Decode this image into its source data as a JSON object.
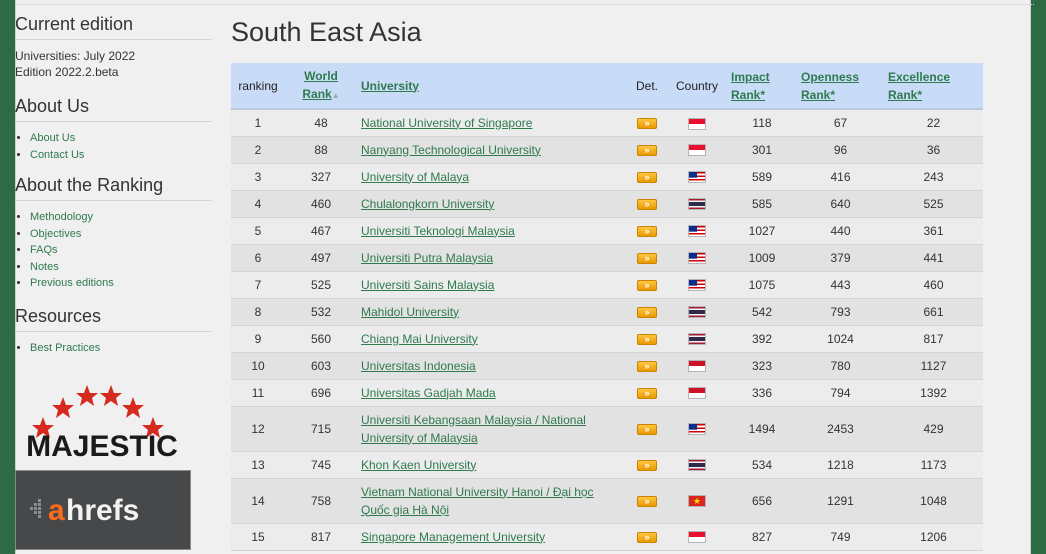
{
  "sidebar": {
    "current_edition": {
      "heading": "Current edition",
      "line1": "Universities: July 2022",
      "line2": "Edition 2022.2.beta"
    },
    "about_us": {
      "heading": "About Us",
      "items": [
        "About Us",
        "Contact Us"
      ]
    },
    "about_ranking": {
      "heading": "About the Ranking",
      "items": [
        "Methodology",
        "Objectives",
        "FAQs",
        "Notes",
        "Previous editions"
      ]
    },
    "resources": {
      "heading": "Resources",
      "items": [
        "Best Practices"
      ]
    },
    "logos": {
      "majestic": "MAJESTIC",
      "ahrefs_a": "a",
      "ahrefs_rest": "hrefs"
    }
  },
  "main": {
    "title": "South East Asia",
    "columns": {
      "ranking": "ranking",
      "world_rank_1": "World",
      "world_rank_2": "Rank",
      "university": "University",
      "det": "Det.",
      "country": "Country",
      "impact_1": "Impact",
      "impact_2": "Rank*",
      "openness_1": "Openness",
      "openness_2": "Rank*",
      "excellence_1": "Excellence",
      "excellence_2": "Rank*"
    },
    "det_label": "»",
    "rows": [
      {
        "ranking": "1",
        "world": "48",
        "university": "National University of Singapore",
        "country": "SG",
        "impact": "118",
        "openness": "67",
        "excellence": "22"
      },
      {
        "ranking": "2",
        "world": "88",
        "university": "Nanyang Technological University",
        "country": "SG",
        "impact": "301",
        "openness": "96",
        "excellence": "36"
      },
      {
        "ranking": "3",
        "world": "327",
        "university": "University of Malaya",
        "country": "MY",
        "impact": "589",
        "openness": "416",
        "excellence": "243"
      },
      {
        "ranking": "4",
        "world": "460",
        "university": "Chulalongkorn University",
        "country": "TH",
        "impact": "585",
        "openness": "640",
        "excellence": "525"
      },
      {
        "ranking": "5",
        "world": "467",
        "university": "Universiti Teknologi Malaysia",
        "country": "MY",
        "impact": "1027",
        "openness": "440",
        "excellence": "361"
      },
      {
        "ranking": "6",
        "world": "497",
        "university": "Universiti Putra Malaysia",
        "country": "MY",
        "impact": "1009",
        "openness": "379",
        "excellence": "441"
      },
      {
        "ranking": "7",
        "world": "525",
        "university": "Universiti Sains Malaysia",
        "country": "MY",
        "impact": "1075",
        "openness": "443",
        "excellence": "460"
      },
      {
        "ranking": "8",
        "world": "532",
        "university": "Mahidol University",
        "country": "TH",
        "impact": "542",
        "openness": "793",
        "excellence": "661"
      },
      {
        "ranking": "9",
        "world": "560",
        "university": "Chiang Mai University",
        "country": "TH",
        "impact": "392",
        "openness": "1024",
        "excellence": "817"
      },
      {
        "ranking": "10",
        "world": "603",
        "university": "Universitas Indonesia",
        "country": "ID",
        "impact": "323",
        "openness": "780",
        "excellence": "1127"
      },
      {
        "ranking": "11",
        "world": "696",
        "university": "Universitas Gadjah Mada",
        "country": "ID",
        "impact": "336",
        "openness": "794",
        "excellence": "1392"
      },
      {
        "ranking": "12",
        "world": "715",
        "university": "Universiti Kebangsaan Malaysia / National University of Malaysia",
        "country": "MY",
        "impact": "1494",
        "openness": "2453",
        "excellence": "429"
      },
      {
        "ranking": "13",
        "world": "745",
        "university": "Khon Kaen University",
        "country": "TH",
        "impact": "534",
        "openness": "1218",
        "excellence": "1173"
      },
      {
        "ranking": "14",
        "world": "758",
        "university": "Vietnam National University Hanoi / Đại học Quốc gia Hà Nội",
        "country": "VN",
        "impact": "656",
        "openness": "1291",
        "excellence": "1048"
      },
      {
        "ranking": "15",
        "world": "817",
        "university": "Singapore Management University",
        "country": "SG",
        "impact": "827",
        "openness": "749",
        "excellence": "1206"
      }
    ]
  }
}
